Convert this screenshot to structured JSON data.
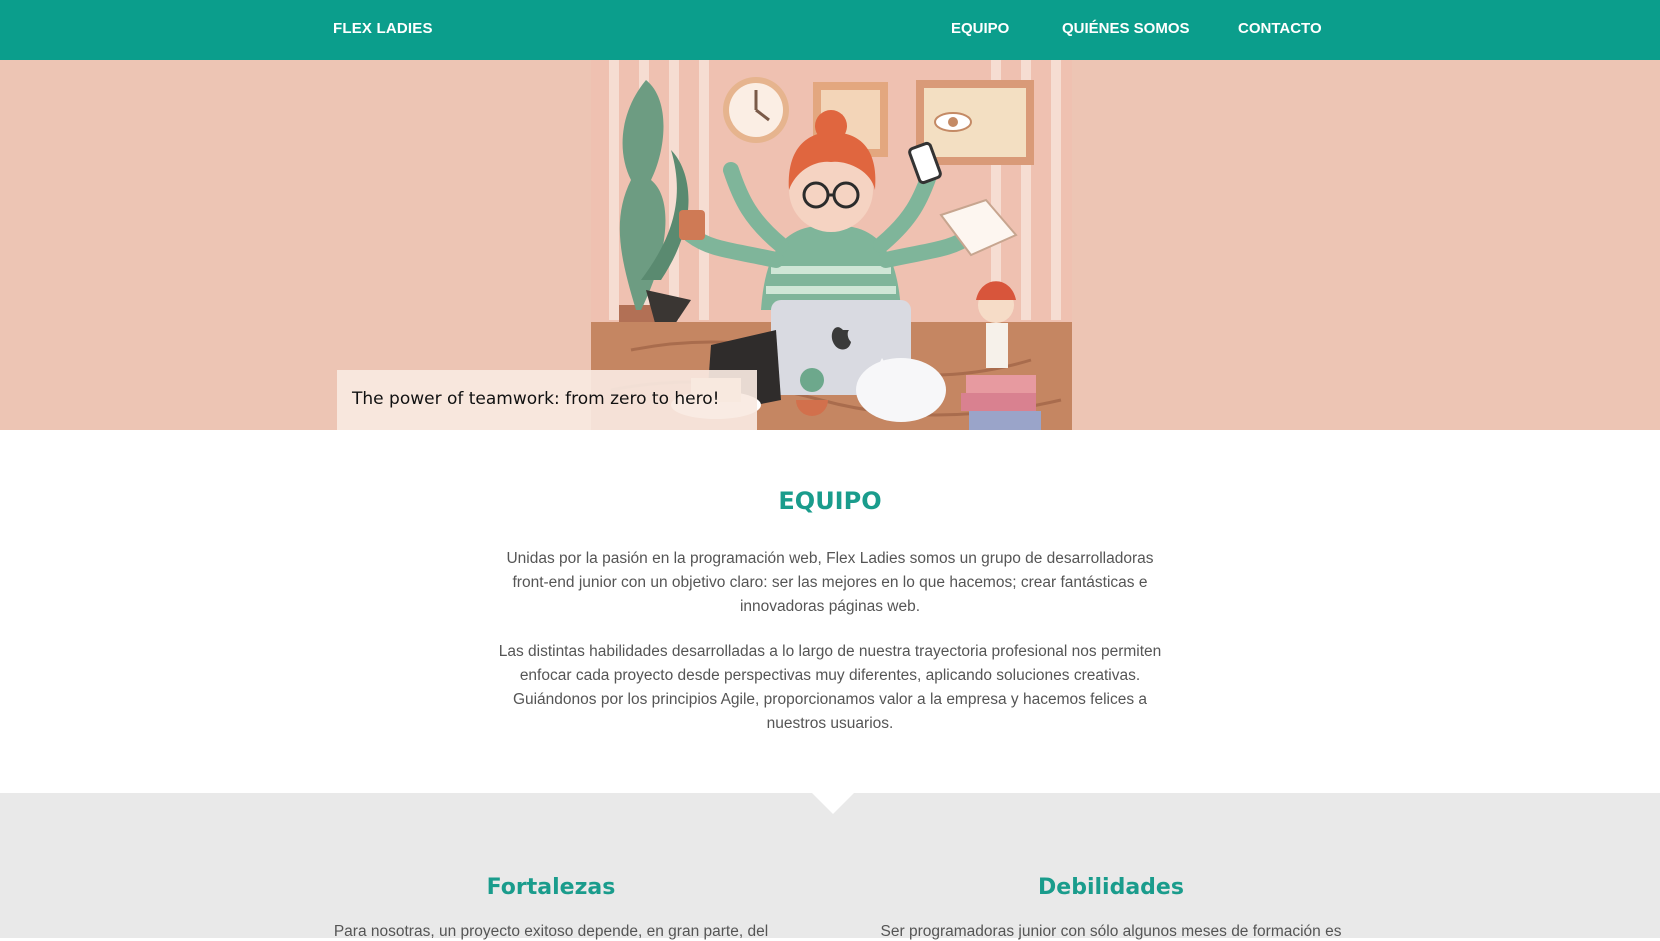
{
  "nav": {
    "brand": "FLEX LADIES",
    "links": [
      "EQUIPO",
      "QUIÉNES SOMOS",
      "CONTACTO"
    ]
  },
  "hero": {
    "caption": "The power of teamwork: from zero to hero!"
  },
  "equipo": {
    "title": "EQUIPO",
    "paragraphs": [
      "Unidas por la pasión en la programación web, Flex Ladies somos un grupo de desarrolladoras front-end junior con un objetivo claro: ser las mejores en lo que hacemos; crear fantásticas e innovadoras páginas web.",
      "Las distintas habilidades desarrolladas a lo largo de nuestra trayectoria profesional nos permiten enfocar cada proyecto desde perspectivas muy diferentes, aplicando soluciones creativas. Guiándonos por los principios Agile, proporcionamos valor a la empresa y hacemos felices a nuestros usuarios."
    ]
  },
  "columns": [
    {
      "title": "Fortalezas",
      "text": "Para nosotras, un proyecto exitoso depende, en gran parte, del"
    },
    {
      "title": "Debilidades",
      "text": "Ser programadoras junior con sólo algunos meses de formación es"
    }
  ],
  "colors": {
    "nav": "#0b9e8c",
    "hero_bg": "#edc5b4",
    "heading": "#1a9c8c",
    "grey_section": "#e9e9e9"
  }
}
